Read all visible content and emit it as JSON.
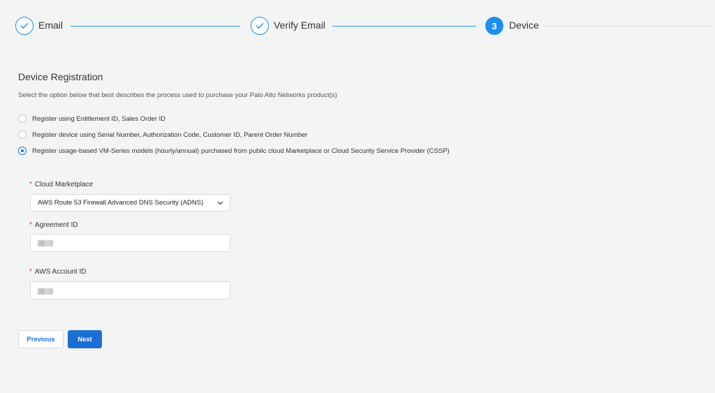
{
  "stepper": {
    "steps": [
      {
        "label": "Email",
        "state": "completed"
      },
      {
        "label": "Verify Email",
        "state": "completed"
      },
      {
        "label": "Device",
        "state": "active",
        "number": "3"
      }
    ]
  },
  "section": {
    "title": "Device Registration",
    "description": "Select the option below that best describes the process used to purchase your Palo Alto Networks product(s)"
  },
  "options": [
    {
      "label": "Register using Entitlement ID, Sales Order ID",
      "selected": false
    },
    {
      "label": "Register device using Serial Number, Authorization Code, Customer ID, Parent Order Number",
      "selected": false
    },
    {
      "label": "Register usage-based VM-Series models (hourly/annual) purchased from public cloud Marketplace or Cloud Security Service Provider (CSSP)",
      "selected": true
    }
  ],
  "form": {
    "cloud_marketplace": {
      "label": "Cloud Marketplace",
      "required_mark": "*",
      "value": "AWS Route 53 Firewall Advanced DNS Security (ADNS)"
    },
    "agreement_id": {
      "label": "Agreement ID",
      "required_mark": "*"
    },
    "aws_account_id": {
      "label": "AWS Account ID",
      "required_mark": "*"
    }
  },
  "buttons": {
    "previous": "Previous",
    "next": "Next"
  },
  "colors": {
    "accent": "#1b8ff0",
    "primary_button": "#1b6fd4",
    "required": "#d9363e",
    "background": "#f3f4f4"
  }
}
